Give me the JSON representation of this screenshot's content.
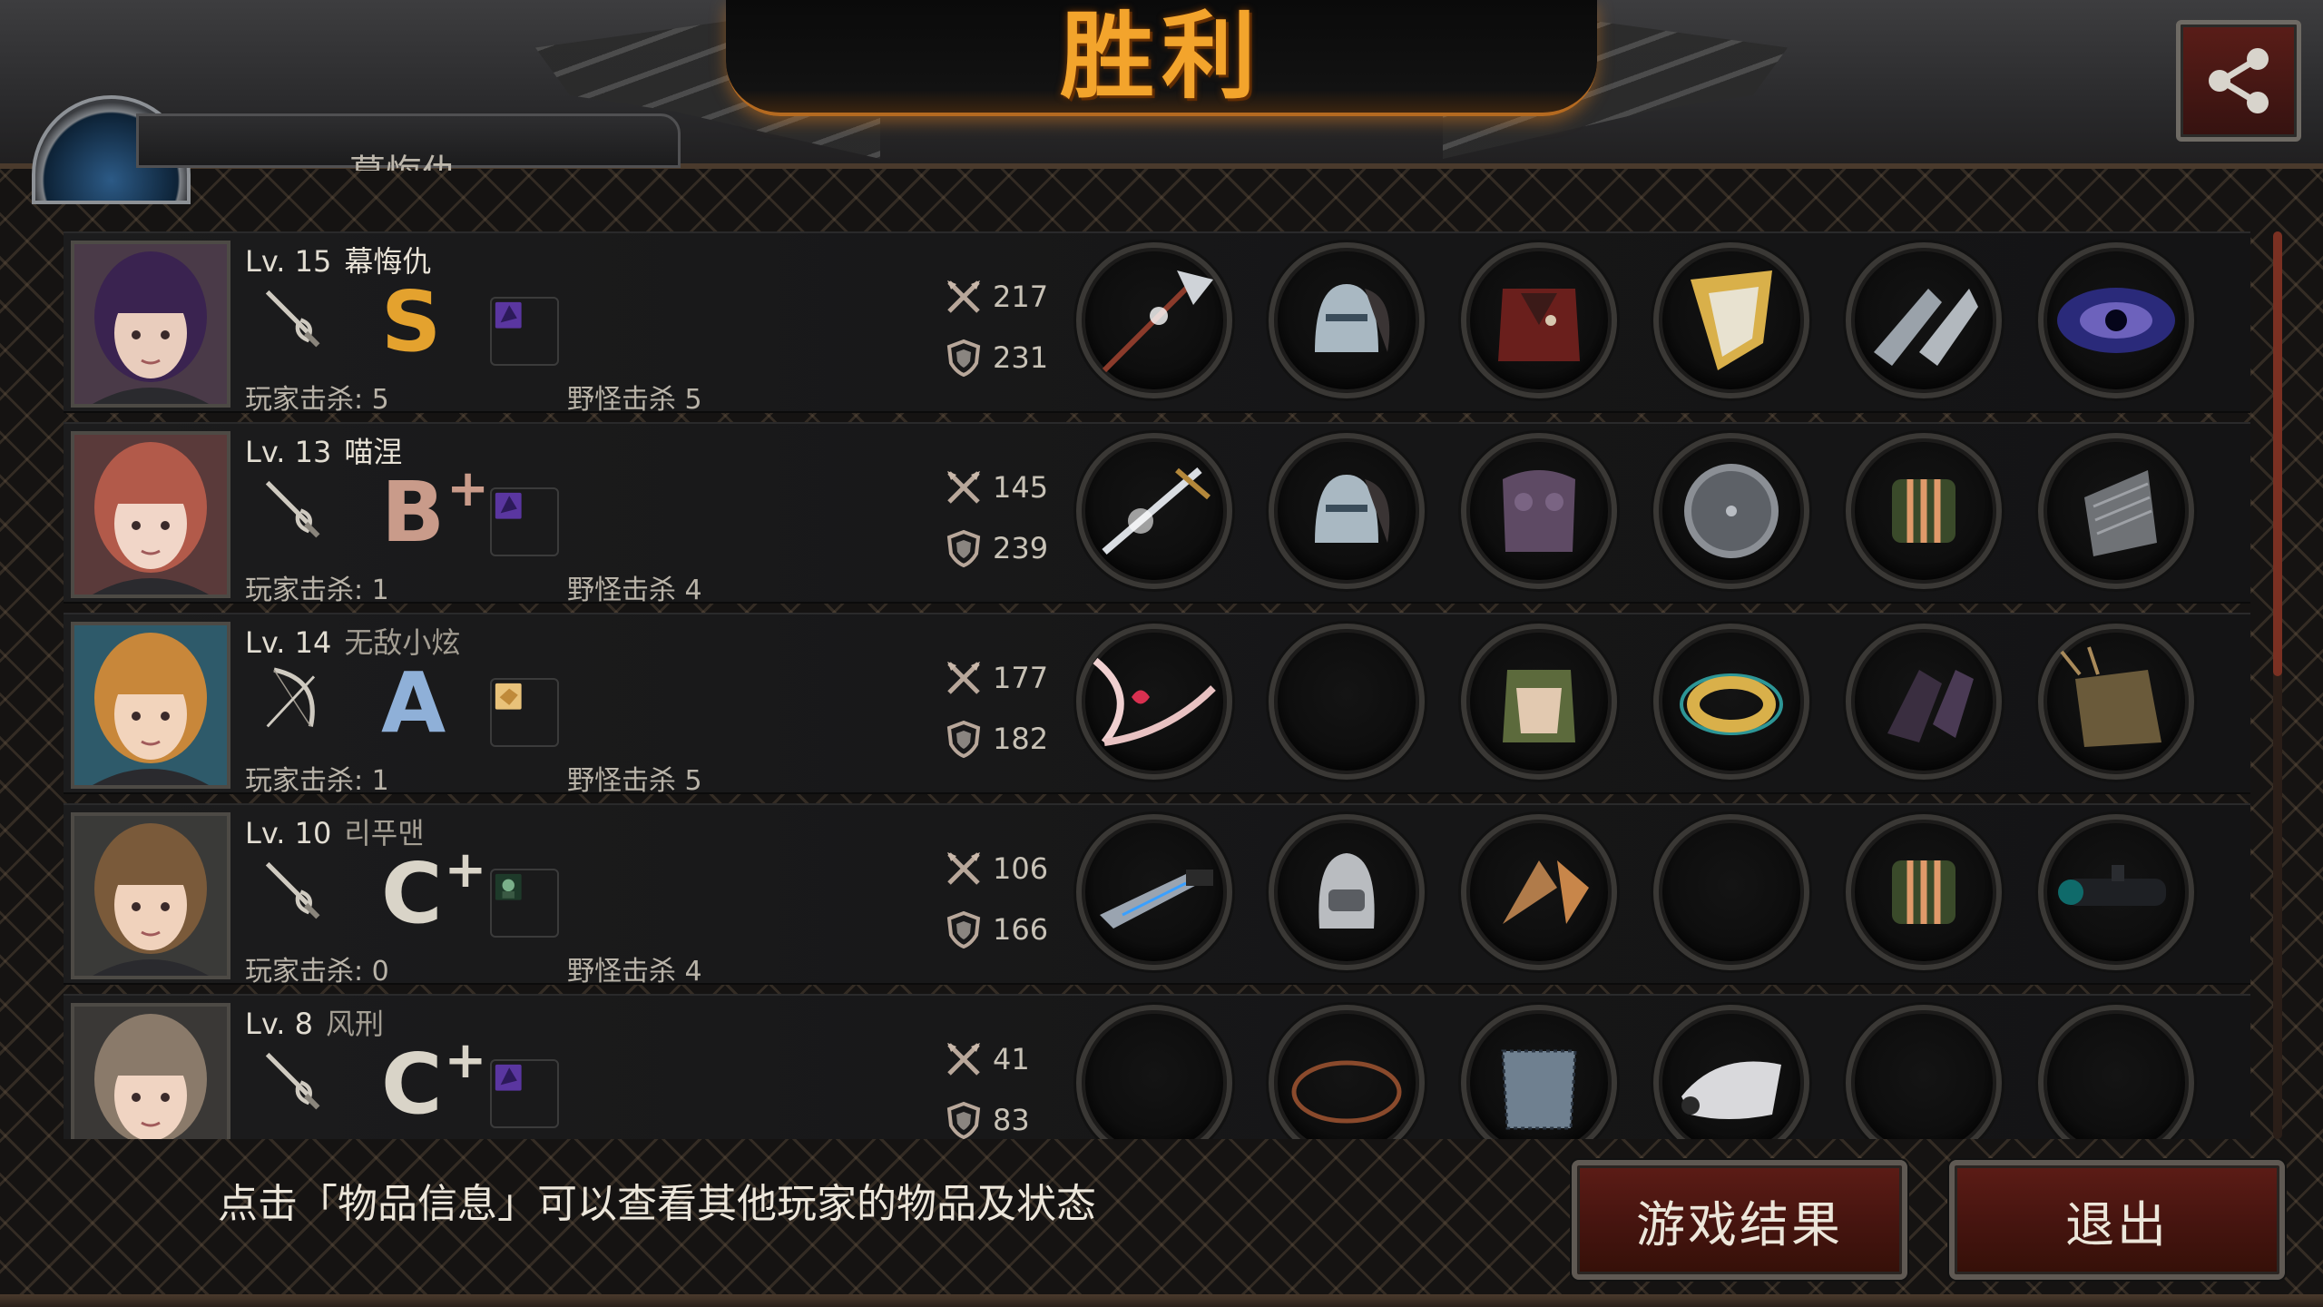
{
  "title": "胜利",
  "top_plate_text": "慕悔仇",
  "hint": "点击「物品信息」可以查看其他玩家的物品及状态",
  "buttons": {
    "results": "游戏结果",
    "exit": "退出"
  },
  "labels": {
    "player_kills": "玩家击杀",
    "monster_kills": "野怪击杀"
  },
  "colors": {
    "title": "#f3a42c",
    "button_bg": "#4a1610",
    "grade_S": "#e4a22e",
    "grade_A": "#8fb0d8",
    "grade_B": "#c99b8a",
    "grade_C": "#d9d4c8"
  },
  "players": [
    {
      "level": "Lv. 15",
      "name": "幕悔仇",
      "name_dim": false,
      "weapon_icon": "rapier-icon",
      "grade": "S",
      "grade_plus": "",
      "grade_color": "#e4a22e",
      "badge_icon": "purple-rune-icon",
      "badge_color": "#4c2c86",
      "player_kills": "玩家击杀: 5",
      "monster_kills": "野怪击杀 5",
      "attack": "217",
      "defense": "231",
      "items": [
        "halberd-icon",
        "knight-helmet-icon",
        "red-armor-icon",
        "gold-shield-icon",
        "chainmail-gloves-icon",
        "galaxy-orb-icon"
      ],
      "avatar": {
        "hair": "#3a2350",
        "skin": "#e9cdbd",
        "bg": "#4a3a48"
      }
    },
    {
      "level": "Lv. 13",
      "name": "喵涅",
      "name_dim": false,
      "weapon_icon": "rapier-icon",
      "grade": "B",
      "grade_plus": "+",
      "grade_color": "#c99b8a",
      "badge_icon": "purple-rune-icon",
      "badge_color": "#4c2c86",
      "player_kills": "玩家击杀: 1",
      "monster_kills": "野怪击杀 4",
      "attack": "145",
      "defense": "239",
      "items": [
        "sword-icon",
        "knight-helmet-icon",
        "purple-armor-icon",
        "steel-disc-icon",
        "striped-gauntlet-icon",
        "magazine-icon"
      ],
      "avatar": {
        "hair": "#b25a4a",
        "skin": "#f1d6c8",
        "bg": "#5a3a3a"
      }
    },
    {
      "level": "Lv. 14",
      "name": "无敌小炫",
      "name_dim": true,
      "weapon_icon": "bow-icon",
      "grade": "A",
      "grade_plus": "",
      "grade_color": "#8fb0d8",
      "badge_icon": "bread-icon",
      "badge_color": "#d6a24a",
      "player_kills": "玩家击杀: 1",
      "monster_kills": "野怪击杀 5",
      "attack": "177",
      "defense": "182",
      "items": [
        "heart-bow-icon",
        "",
        "camo-armor-icon",
        "gold-bracelet-icon",
        "dark-gauntlet-icon",
        "quiver-icon"
      ],
      "avatar": {
        "hair": "#c8873a",
        "skin": "#f2d4bc",
        "bg": "#2e5a6a"
      }
    },
    {
      "level": "Lv. 10",
      "name": "리푸맨",
      "name_dim": true,
      "weapon_icon": "rapier-icon",
      "grade": "C",
      "grade_plus": "+",
      "grade_color": "#d9d4c8",
      "badge_icon": "zombie-icon",
      "badge_color": "#2e5a3a",
      "player_kills": "玩家击杀: 0",
      "monster_kills": "野怪击杀 4",
      "attack": "106",
      "defense": "166",
      "items": [
        "combat-knife-icon",
        "iron-helmet-icon",
        "scale-armor-icon",
        "",
        "striped-gauntlet-icon",
        "scope-icon"
      ],
      "avatar": {
        "hair": "#7a5a3a",
        "skin": "#f0d2bc",
        "bg": "#3a3a38"
      }
    },
    {
      "level": "Lv. 8",
      "name": "风刑",
      "name_dim": true,
      "weapon_icon": "rapier-icon",
      "grade": "C",
      "grade_plus": "+",
      "grade_color": "#d9d4c8",
      "badge_icon": "purple-rune-icon",
      "badge_color": "#4c2c86",
      "player_kills": "",
      "monster_kills": "",
      "attack": "41",
      "defense": "83",
      "items": [
        "",
        "leather-band-icon",
        "chainmail-shirt-icon",
        "white-gloves-icon",
        "",
        ""
      ],
      "avatar": {
        "hair": "#8a7a6a",
        "skin": "#f0d4c2",
        "bg": "#3a3836"
      }
    }
  ]
}
